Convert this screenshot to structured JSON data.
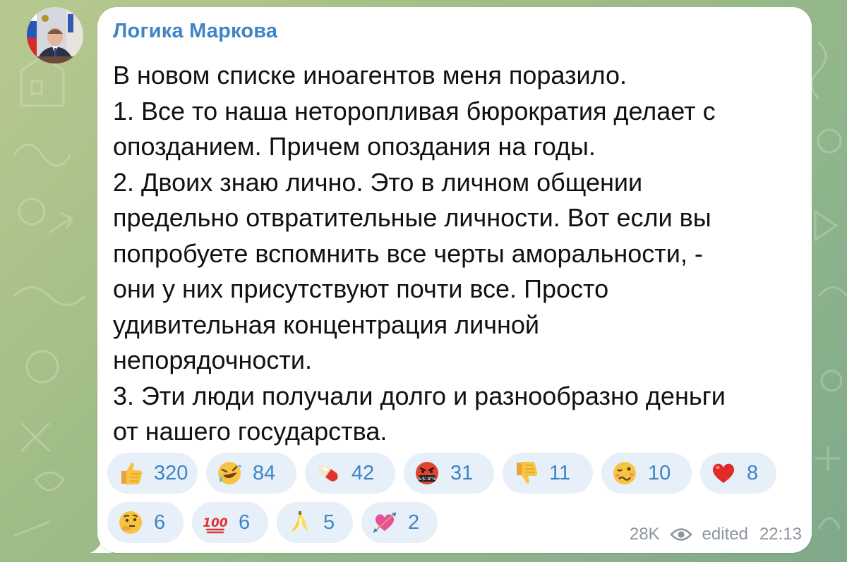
{
  "message": {
    "author": "Логика Маркова",
    "lines": [
      "В новом списке иноагентов меня поразило.",
      "1. Все то наша неторопливая бюрократия делает с",
      "опозданием. Причем опоздания на годы.",
      "2. Двоих знаю лично. Это в личном общении",
      "предельно отвратительные личности. Вот если вы",
      "попробуете вспомнить все черты аморальности, -",
      "они у них присутствуют почти все. Просто",
      "удивительная концентрация личной",
      "непорядочности.",
      "3. Эти люди получали долго и разнообразно деньги",
      "от нашего государства."
    ]
  },
  "reactions": [
    {
      "icon": "thumbs-up-icon",
      "count": "320"
    },
    {
      "icon": "rofl-icon",
      "count": "84"
    },
    {
      "icon": "pill-icon",
      "count": "42"
    },
    {
      "icon": "cursing-face-icon",
      "count": "31"
    },
    {
      "icon": "thumbs-down-icon",
      "count": "11"
    },
    {
      "icon": "woozy-face-icon",
      "count": "10"
    },
    {
      "icon": "red-heart-icon",
      "count": "8"
    },
    {
      "icon": "thinking-face-icon",
      "count": "6"
    },
    {
      "icon": "hundred-points-icon",
      "count": "6"
    },
    {
      "icon": "banana-icon",
      "count": "5"
    },
    {
      "icon": "heart-with-arrow-icon",
      "count": "2"
    }
  ],
  "footer": {
    "views": "28K",
    "edited_label": "edited",
    "time": "22:13"
  },
  "colors": {
    "accent": "#3f85c5",
    "reaction_bg": "#e7eff8",
    "meta_gray": "#8e959e",
    "wallpaper": "#9fbc86"
  }
}
